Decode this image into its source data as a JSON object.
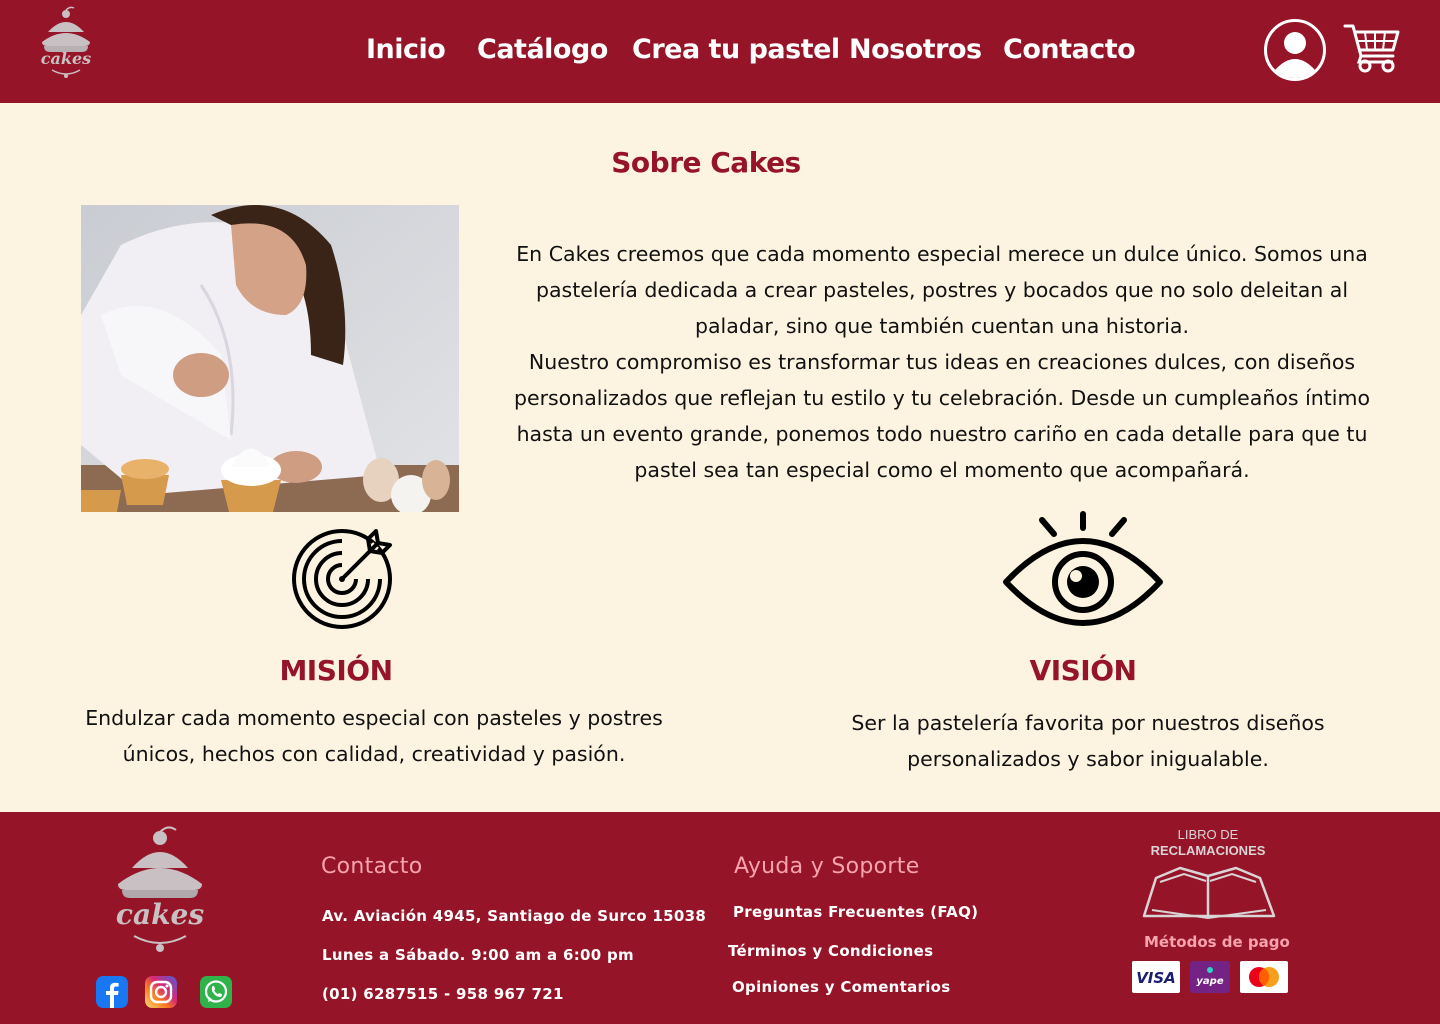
{
  "brand": {
    "name": "cakes"
  },
  "nav": {
    "items": [
      "Inicio",
      "Catálogo",
      "Crea tu pastel",
      "Nosotros",
      "Contacto"
    ]
  },
  "icons": {
    "user": "user-icon",
    "cart": "cart-icon",
    "mission": "target-icon",
    "vision": "eye-icon"
  },
  "about": {
    "title": "Sobre Cakes",
    "paragraph1": "En Cakes creemos que cada momento especial merece un dulce único. Somos una pastelería dedicada a crear pasteles, postres y bocados que no solo deleitan al paladar, sino que también cuentan una historia.",
    "paragraph2": "Nuestro compromiso es transformar tus ideas en creaciones dulces, con diseños personalizados que reflejan tu estilo y tu celebración. Desde un cumpleaños íntimo hasta un evento grande, ponemos todo nuestro cariño en cada detalle para que tu pastel sea tan especial como el momento que acompañará."
  },
  "mission": {
    "title": "MISIÓN",
    "text": "Endulzar cada momento especial con pasteles y postres únicos, hechos con calidad, creatividad y pasión."
  },
  "vision": {
    "title": "VISIÓN",
    "text": "Ser la pastelería favorita por nuestros diseños personalizados y sabor inigualable."
  },
  "footer": {
    "contact": {
      "title": "Contacto",
      "address": "Av. Aviación 4945, Santiago de Surco 15038",
      "hours": "Lunes a Sábado. 9:00 am a 6:00 pm",
      "phone": "(01) 6287515 - 958 967 721"
    },
    "help": {
      "title": "Ayuda y Soporte",
      "items": [
        "Preguntas Frecuentes (FAQ)",
        "Términos y Condiciones",
        "Opiniones y Comentarios"
      ]
    },
    "complaints": {
      "line1": "LIBRO DE",
      "line2": "RECLAMACIONES"
    },
    "payments": {
      "title": "Métodos de pago",
      "methods": [
        "VISA",
        "yape",
        "mastercard"
      ]
    },
    "social": [
      "facebook-icon",
      "instagram-icon",
      "whatsapp-icon"
    ]
  },
  "colors": {
    "brand": "#951428",
    "background": "#fdf3e1",
    "footer_heading": "#f6a3ad"
  }
}
